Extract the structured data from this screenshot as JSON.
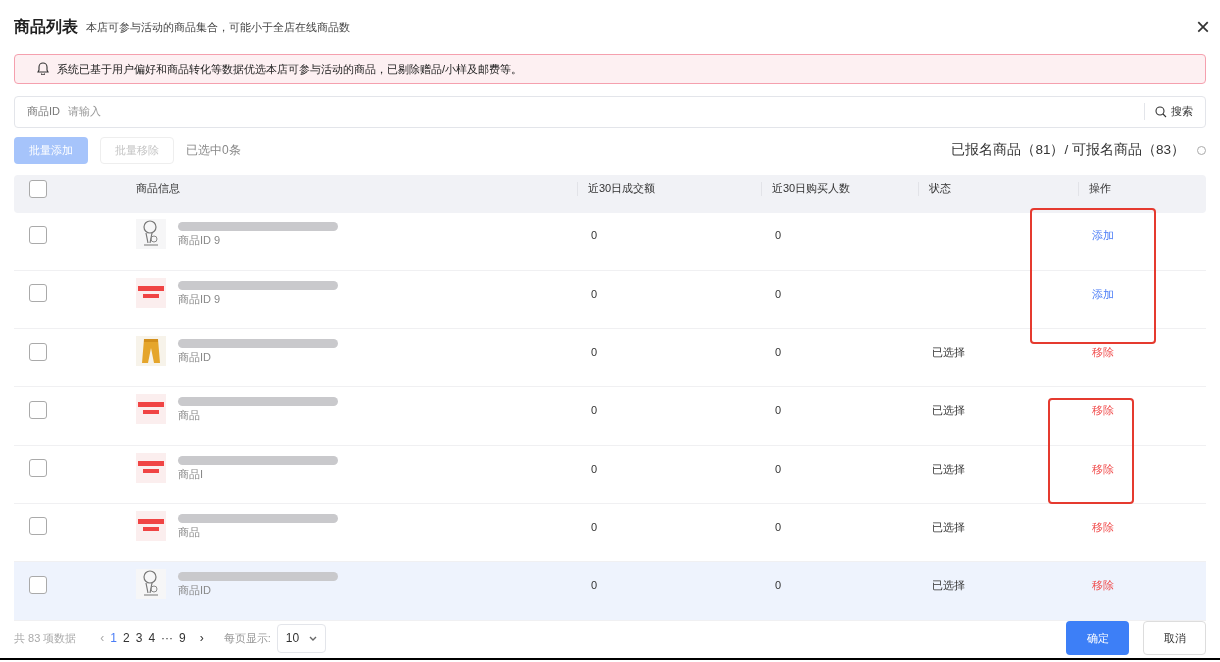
{
  "dialog": {
    "title": "商品列表",
    "subtitle": "本店可参与活动的商品集合，可能小于全店在线商品数",
    "close": "×"
  },
  "notice": "系统已基于用户偏好和商品转化等数据优选本店可参与活动的商品，已剔除赠品/小样及邮费等。",
  "search": {
    "label": "商品ID",
    "placeholder": "请输入",
    "button": "搜索"
  },
  "toolbar": {
    "batch_add": {
      "label": "批量添加",
      "disabled": true
    },
    "batch_remove": {
      "label": "批量移除",
      "disabled": true
    },
    "selected_count": "已选中0条",
    "summary": "已报名商品（81）/ 可报名商品（83）"
  },
  "table": {
    "select_all": false,
    "columns": [
      "商品信息",
      "近30日成交额",
      "近30日购买人数",
      "状态",
      "操作"
    ],
    "rows": [
      {
        "checked": false,
        "highlighted": false,
        "id_label": "商品ID 9",
        "sales": "0",
        "buyers": "0",
        "status": "",
        "action": {
          "kind": "add",
          "label": "添加"
        }
      },
      {
        "checked": false,
        "highlighted": false,
        "id_label": "商品ID 9",
        "sales": "0",
        "buyers": "0",
        "status": "",
        "action": {
          "kind": "add",
          "label": "添加"
        }
      },
      {
        "checked": false,
        "highlighted": false,
        "id_label": "商品ID",
        "sales": "0",
        "buyers": "0",
        "status": "已选择",
        "action": {
          "kind": "remove",
          "label": "移除"
        }
      },
      {
        "checked": false,
        "highlighted": false,
        "id_label": "商品",
        "sales": "0",
        "buyers": "0",
        "status": "已选择",
        "action": {
          "kind": "remove",
          "label": "移除"
        }
      },
      {
        "checked": false,
        "highlighted": false,
        "id_label": "商品I",
        "sales": "0",
        "buyers": "0",
        "status": "已选择",
        "action": {
          "kind": "remove",
          "label": "移除"
        }
      },
      {
        "checked": false,
        "highlighted": false,
        "id_label": "商品",
        "sales": "0",
        "buyers": "0",
        "status": "已选择",
        "action": {
          "kind": "remove",
          "label": "移除"
        }
      },
      {
        "checked": false,
        "highlighted": true,
        "id_label": "商品ID",
        "sales": "0",
        "buyers": "0",
        "status": "已选择",
        "action": {
          "kind": "remove",
          "label": "移除"
        }
      }
    ]
  },
  "pagination": {
    "total": "共 83 项数据",
    "prev": "‹",
    "pages": [
      {
        "label": "1",
        "selected": true
      },
      {
        "label": "2",
        "selected": false
      },
      {
        "label": "3",
        "selected": false
      },
      {
        "label": "4",
        "selected": false
      },
      {
        "label": "···",
        "selected": false
      },
      {
        "label": "9",
        "selected": false
      }
    ],
    "next": "›",
    "page_size_label": "每页显示:",
    "page_size": "10"
  },
  "buttons": {
    "confirm": "确定",
    "cancel": "取消"
  }
}
